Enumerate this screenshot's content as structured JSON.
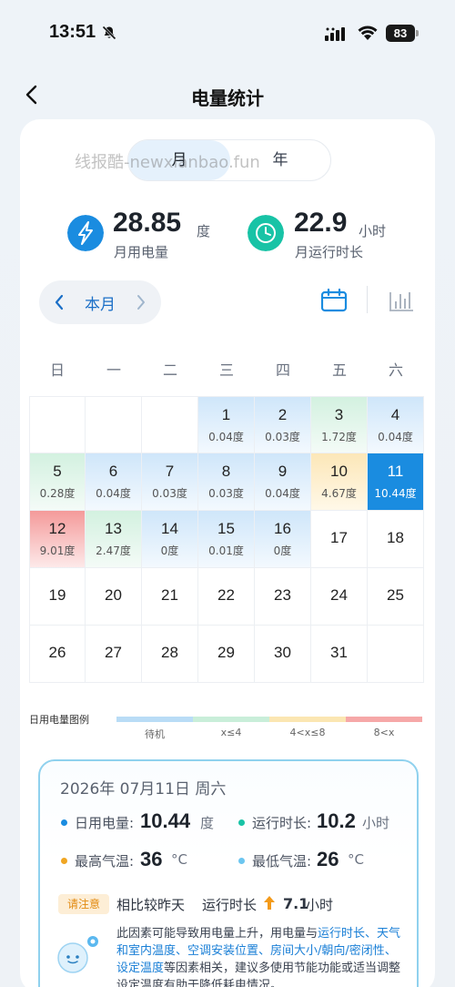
{
  "status_bar": {
    "time": "13:51",
    "battery": "83"
  },
  "header": {
    "title": "电量统计"
  },
  "segment": {
    "month": "月",
    "year": "年"
  },
  "watermark": "线报酷-newxianbao.fun",
  "stats": {
    "power": {
      "value": "28.85",
      "unit": "度",
      "label": "月用电量"
    },
    "runtime": {
      "value": "22.9",
      "unit": "小时",
      "label": "月运行时长"
    }
  },
  "month_nav": {
    "label": "本月"
  },
  "weekdays": [
    "日",
    "一",
    "二",
    "三",
    "四",
    "五",
    "六"
  ],
  "calendar": {
    "days": [
      {
        "day": "1",
        "kwh": "0.04度",
        "level": "standby"
      },
      {
        "day": "2",
        "kwh": "0.03度",
        "level": "standby"
      },
      {
        "day": "3",
        "kwh": "1.72度",
        "level": "low"
      },
      {
        "day": "4",
        "kwh": "0.04度",
        "level": "standby"
      },
      {
        "day": "5",
        "kwh": "0.28度",
        "level": "low"
      },
      {
        "day": "6",
        "kwh": "0.04度",
        "level": "standby"
      },
      {
        "day": "7",
        "kwh": "0.03度",
        "level": "standby"
      },
      {
        "day": "8",
        "kwh": "0.03度",
        "level": "standby"
      },
      {
        "day": "9",
        "kwh": "0.04度",
        "level": "standby"
      },
      {
        "day": "10",
        "kwh": "4.67度",
        "level": "mid"
      },
      {
        "day": "11",
        "kwh": "10.44度",
        "level": "selected"
      },
      {
        "day": "12",
        "kwh": "9.01度",
        "level": "high"
      },
      {
        "day": "13",
        "kwh": "2.47度",
        "level": "low"
      },
      {
        "day": "14",
        "kwh": "0度",
        "level": "standby"
      },
      {
        "day": "15",
        "kwh": "0.01度",
        "level": "standby"
      },
      {
        "day": "16",
        "kwh": "0度",
        "level": "standby"
      },
      {
        "day": "17",
        "kwh": "",
        "level": "none"
      },
      {
        "day": "18",
        "kwh": "",
        "level": "none"
      },
      {
        "day": "19",
        "kwh": "",
        "level": "none"
      },
      {
        "day": "20",
        "kwh": "",
        "level": "none"
      },
      {
        "day": "21",
        "kwh": "",
        "level": "none"
      },
      {
        "day": "22",
        "kwh": "",
        "level": "none"
      },
      {
        "day": "23",
        "kwh": "",
        "level": "none"
      },
      {
        "day": "24",
        "kwh": "",
        "level": "none"
      },
      {
        "day": "25",
        "kwh": "",
        "level": "none"
      },
      {
        "day": "26",
        "kwh": "",
        "level": "none"
      },
      {
        "day": "27",
        "kwh": "",
        "level": "none"
      },
      {
        "day": "28",
        "kwh": "",
        "level": "none"
      },
      {
        "day": "29",
        "kwh": "",
        "level": "none"
      },
      {
        "day": "30",
        "kwh": "",
        "level": "none"
      },
      {
        "day": "31",
        "kwh": "",
        "level": "none"
      }
    ]
  },
  "legend": {
    "label": "日用电量图例",
    "items": [
      {
        "text": "待机",
        "color": "#b9dcf6"
      },
      {
        "text": "x≤4",
        "color": "#c9eed9"
      },
      {
        "text": "4<x≤8",
        "color": "#fbe6b2"
      },
      {
        "text": "8<x",
        "color": "#f6a8a8"
      }
    ]
  },
  "detail": {
    "date": "2026年 07月11日  周六",
    "daily_power": {
      "label": "日用电量:",
      "value": "10.44",
      "unit": "度"
    },
    "runtime": {
      "label": "运行时长:",
      "value": "10.2",
      "unit": "小时"
    },
    "max_temp": {
      "label": "最高气温:",
      "value": "36",
      "unit": "°C"
    },
    "min_temp": {
      "label": "最低气温:",
      "value": "26",
      "unit": "°C"
    },
    "notice_badge": "请注意",
    "notice_compare": "相比较昨天",
    "notice_metric": "运行时长",
    "notice_value": "7.1",
    "notice_unit": "小时",
    "para_a": "此因素可能导致用电量上升，用电量与",
    "para_link1": "运行时长、天气和室内温度、空调安装位置、房间大小/朝向/密闭性、设定温度",
    "para_b": "等因素相关，建议多使用节能功能或适当调整设定温度有助于降低耗电情况。"
  },
  "colors": {
    "standby": "#dcedfb",
    "low": "#dff5e8",
    "mid": "#fdf0cc",
    "high": "#f7b8b8",
    "selected": "#1a8ce0",
    "accent": "#1b6fc7"
  }
}
